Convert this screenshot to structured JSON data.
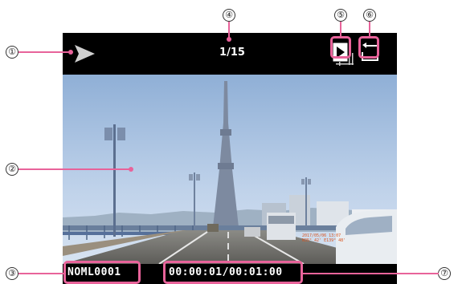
{
  "callouts": {
    "c1": "①",
    "c2": "②",
    "c3": "③",
    "c4": "④",
    "c5": "⑤",
    "c6": "⑥",
    "c7": "⑦"
  },
  "screen": {
    "counter": "1/15",
    "filename": "NOML0001",
    "timecode": "00:00:01/00:01:00",
    "stamp_line1": "2017/05/06 13:07",
    "stamp_line2": "N35° 42' E139° 48'"
  },
  "icons": {
    "play": "play-icon",
    "mode": "playback-mode-icon",
    "return": "return-icon"
  },
  "colors": {
    "accent": "#e8639a",
    "screen_bg": "#000000",
    "sky": "#a9c1e0",
    "stamp": "#d9531e"
  }
}
